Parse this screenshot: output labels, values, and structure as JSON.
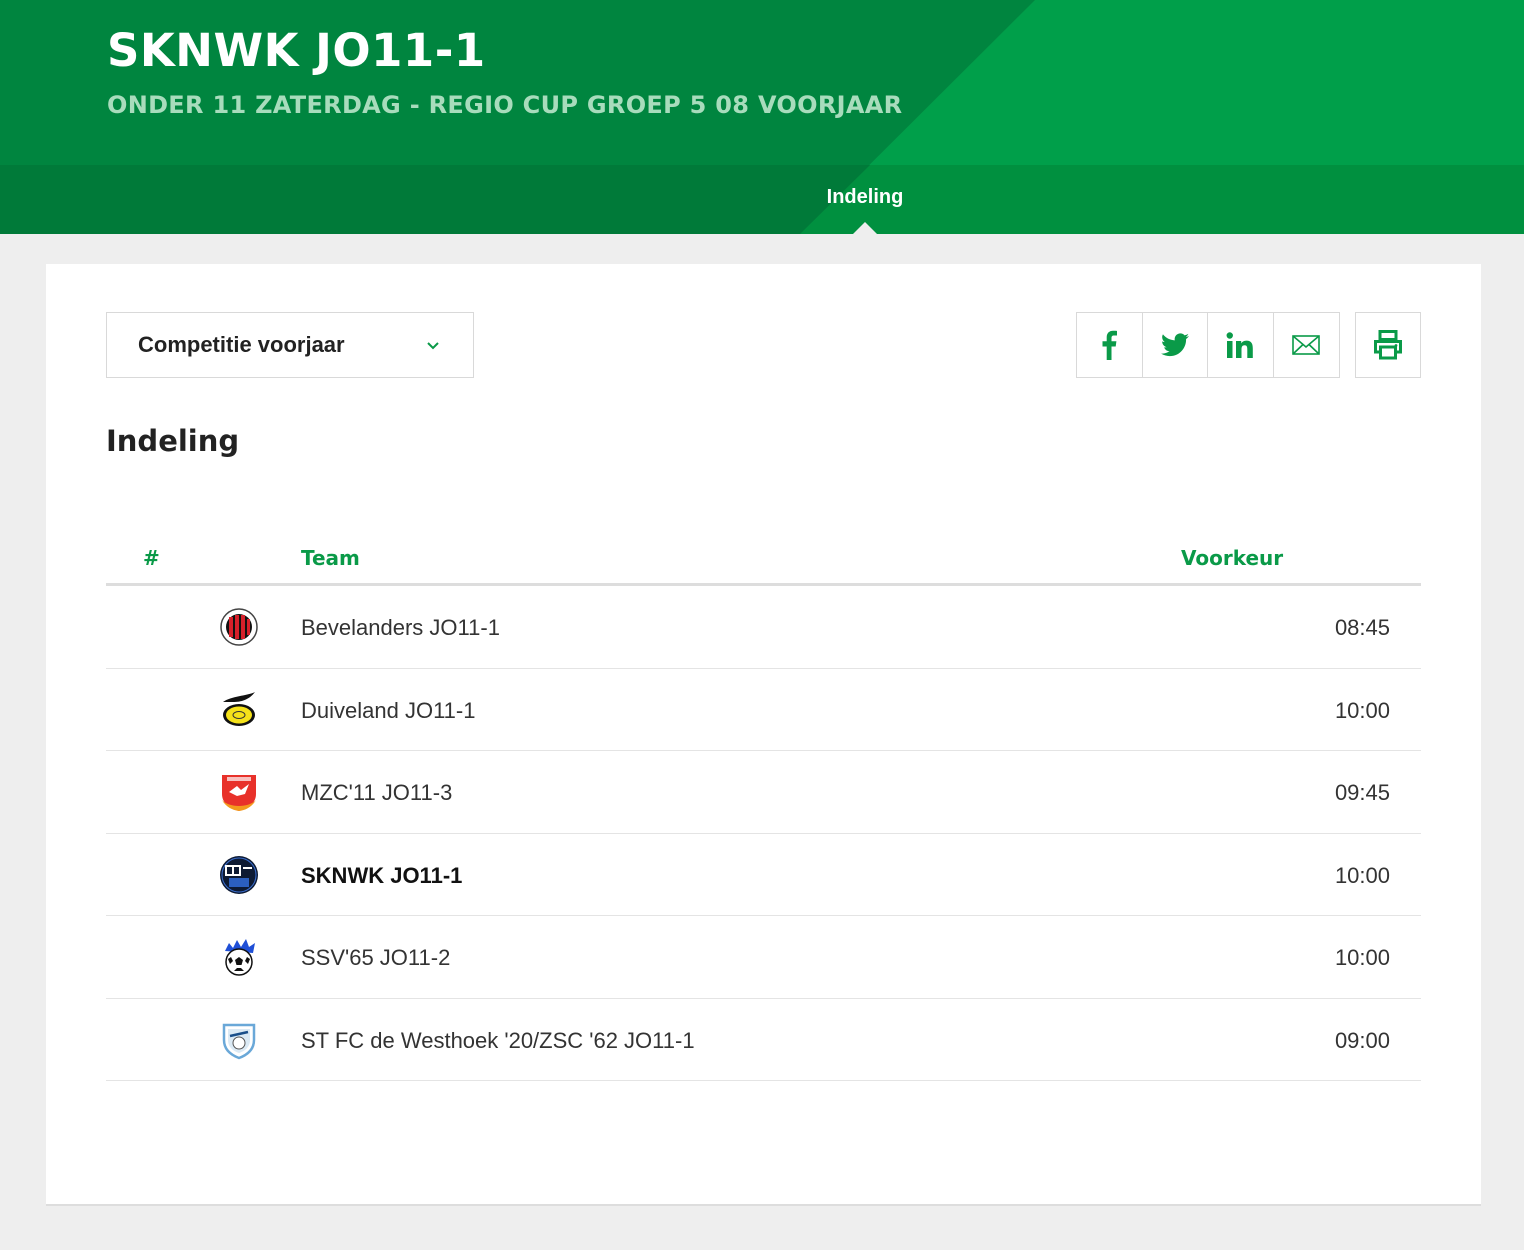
{
  "header": {
    "title": "SKNWK JO11-1",
    "subtitle": "ONDER 11 ZATERDAG - REGIO CUP GROEP 5 08 VOORJAAR",
    "tab": "Indeling"
  },
  "toolbar": {
    "select_value": "Competitie voorjaar",
    "share_icons": [
      "facebook-icon",
      "twitter-icon",
      "linkedin-icon",
      "mail-icon"
    ],
    "print_icon": "printer-icon"
  },
  "section": {
    "title": "Indeling"
  },
  "table": {
    "headers": {
      "num": "#",
      "team": "Team",
      "pref": "Voorkeur"
    },
    "rows": [
      {
        "team": "Bevelanders JO11-1",
        "pref": "08:45",
        "logo": "bevelanders-logo"
      },
      {
        "team": "Duiveland JO11-1",
        "pref": "10:00",
        "logo": "duiveland-logo"
      },
      {
        "team": "MZC'11 JO11-3",
        "pref": "09:45",
        "logo": "mzc11-logo"
      },
      {
        "team": "SKNWK JO11-1",
        "pref": "10:00",
        "logo": "sknwk-logo",
        "highlight": true
      },
      {
        "team": "SSV'65 JO11-2",
        "pref": "10:00",
        "logo": "ssv65-logo"
      },
      {
        "team": "ST FC de Westhoek '20/ZSC '62 JO11-1",
        "pref": "09:00",
        "logo": "westhoek-logo"
      }
    ]
  },
  "colors": {
    "brand_green": "#00853f",
    "brand_green_light": "#009f4a",
    "accent_green": "#0a9a48",
    "background": "#eeeeee"
  }
}
